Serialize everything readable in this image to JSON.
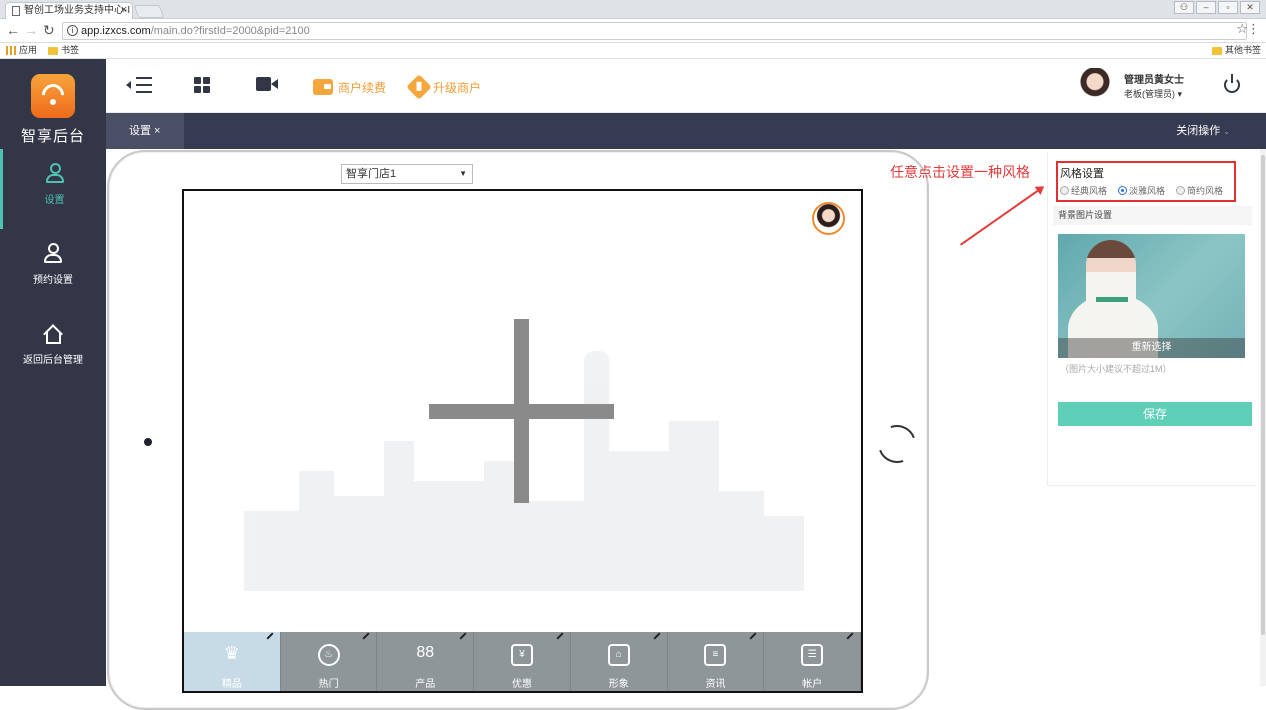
{
  "browser": {
    "tab_title": "智创工场业务支持中心-I",
    "tab_close": "×",
    "url_host": "app.izxcs.com",
    "url_path": "/main.do?firstId=2000&pid=2100",
    "bookmarks": {
      "apps": "应用",
      "bookmarks": "书签",
      "other": "其他书签"
    }
  },
  "sidebar": {
    "brand": "智享后台",
    "items": [
      {
        "label": "设置",
        "icon": "user-icon",
        "active": true
      },
      {
        "label": "预约设置",
        "icon": "user-icon",
        "active": false
      },
      {
        "label": "返回后台管理",
        "icon": "home-icon",
        "active": false
      }
    ]
  },
  "topbar": {
    "renew_label": "商户续费",
    "upgrade_label": "升级商户",
    "user_name": "管理员黄女士",
    "user_role": "老板(管理员) ▾"
  },
  "subbar": {
    "tab_label": "设置 ×",
    "close_ops": "关闭操作",
    "close_ops_caret": "⌄"
  },
  "preview": {
    "store_select": "智享门店1",
    "nav_items": [
      {
        "label": "精品",
        "icon": "crown-icon",
        "glyph": "♛",
        "active": true
      },
      {
        "label": "热门",
        "icon": "flame-icon",
        "glyph": "♨",
        "active": false
      },
      {
        "label": "产品",
        "icon": "clover-icon",
        "glyph": "88",
        "active": false
      },
      {
        "label": "优惠",
        "icon": "coupon-icon",
        "glyph": "¥",
        "active": false
      },
      {
        "label": "形象",
        "icon": "store-icon",
        "glyph": "⌂",
        "active": false
      },
      {
        "label": "资讯",
        "icon": "news-icon",
        "glyph": "≡",
        "active": false
      },
      {
        "label": "帐户",
        "icon": "idcard-icon",
        "glyph": "☰",
        "active": false
      }
    ]
  },
  "annotation": "任意点击设置一种风格",
  "panel": {
    "style_title": "风格设置",
    "styles": [
      {
        "label": "经典风格",
        "checked": false
      },
      {
        "label": "淡雅风格",
        "checked": true
      },
      {
        "label": "简约风格",
        "checked": false
      }
    ],
    "bg_title": "背景图片设置",
    "reselect": "重新选择",
    "hint": "（图片大小建议不超过1M）",
    "save": "保存"
  },
  "colors": {
    "accent": "#5fcfb8",
    "sidebar": "#333647",
    "orange": "#f29b36",
    "annotation": "#e33a3a"
  }
}
